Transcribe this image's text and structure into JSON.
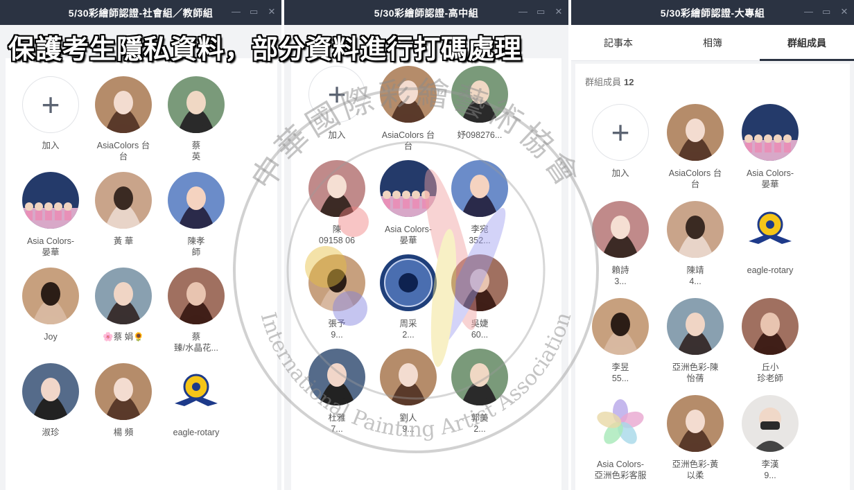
{
  "windows": [
    {
      "title": "5/30彩繪師認證-社會組／教師組"
    },
    {
      "title": "5/30彩繪師認證-高中組"
    },
    {
      "title": "5/30彩繪師認證-大專組"
    }
  ],
  "controls": {
    "minimize": "—",
    "maximize": "▭",
    "close": "✕"
  },
  "banner": {
    "text": "保護考生隱私資料，部分資料進行打碼處理"
  },
  "tabs": [
    "記事本",
    "相簿",
    "群組成員"
  ],
  "group_header": {
    "label": "群組成員",
    "count": "12"
  },
  "add_label": "加入",
  "win1_members": [
    "AsiaColors 台\n台",
    "蔡\n英",
    "Asia Colors-\n晏華",
    "黃 華",
    "陳孝\n師",
    "Joy",
    "🌸蔡 娟🌻",
    "蔡\n臻/水晶花...",
    "淑珍",
    "楊 頻",
    "eagle-rotary"
  ],
  "win2_members": [
    "AsiaColors 台\n台",
    "妤098276...",
    "陳\n09158 06",
    "Asia Colors-\n晏華",
    "李宛\n352...",
    "張予\n9...",
    "周采\n2...",
    "吳婕\n60...",
    "杜雅\n7...",
    "劉人\n9...",
    "郭美\n2..."
  ],
  "win3_members": [
    "AsiaColors 台\n台",
    "Asia Colors-\n晏華",
    "賴詩\n3...",
    "陳靖\n4...",
    "eagle-rotary",
    "李昱\n55...",
    "亞洲色彩-陳\n怡蒨",
    "丘小\n珍老師",
    "Asia Colors-\n亞洲色彩客服",
    "亞洲色彩-黃\n以柔",
    "李漢\n9..."
  ],
  "watermark": {
    "cn": "中華國際彩繪藝術協會",
    "en": "International Painting Artist Association"
  },
  "colors": {
    "titlebar": "#2b3342",
    "window_bg": "#f2f3f5"
  }
}
